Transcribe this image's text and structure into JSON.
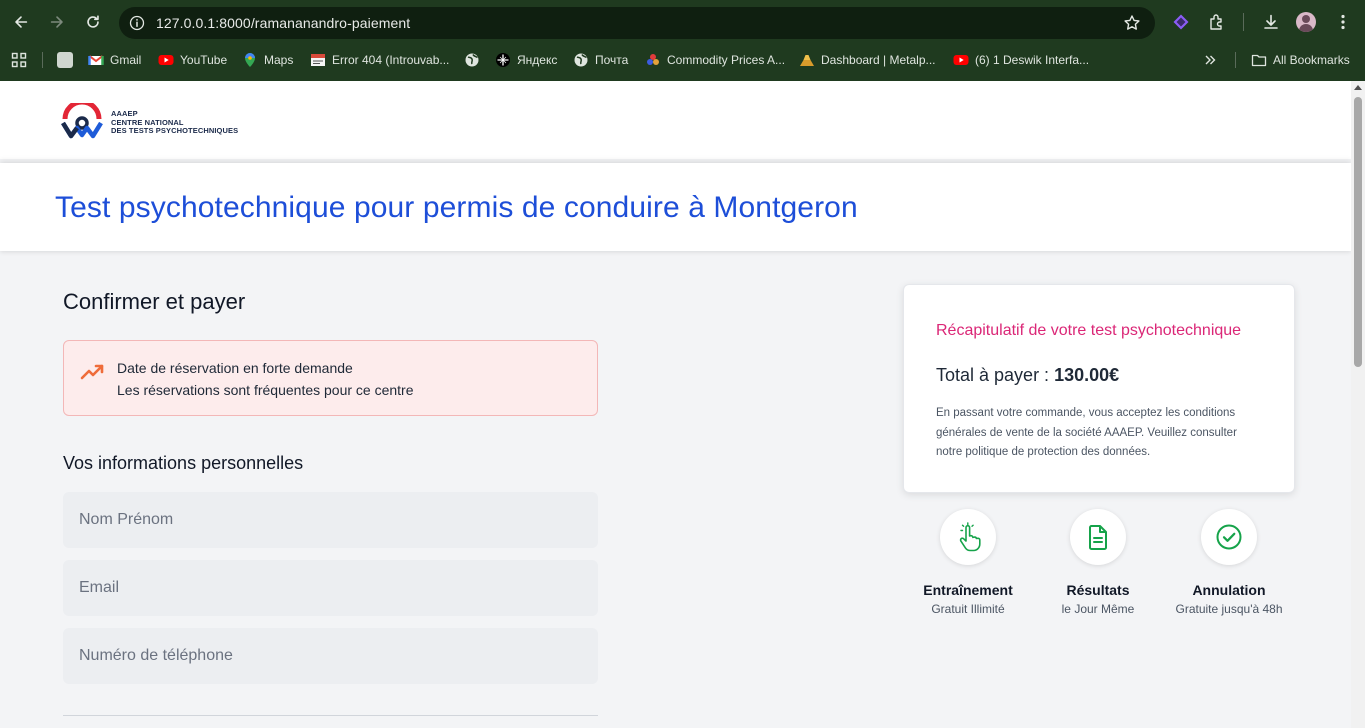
{
  "browser": {
    "url": "127.0.0.1:8000/ramananandro-paiement",
    "bookmarks": [
      {
        "label": "",
        "icon": "apps-grid-icon"
      },
      {
        "label": "",
        "icon": "page-icon"
      },
      {
        "label": "Gmail",
        "icon": "gmail-icon"
      },
      {
        "label": "YouTube",
        "icon": "youtube-icon"
      },
      {
        "label": "Maps",
        "icon": "maps-icon"
      },
      {
        "label": "Error 404 (Introuvab...",
        "icon": "error-page-icon"
      },
      {
        "label": "",
        "icon": "globe-icon"
      },
      {
        "label": "Яндекс",
        "icon": "yandex-icon"
      },
      {
        "label": "Почта",
        "icon": "globe-icon"
      },
      {
        "label": "Commodity Prices A...",
        "icon": "commodity-icon"
      },
      {
        "label": "Dashboard | Metalp...",
        "icon": "metalp-icon"
      },
      {
        "label": "(6) 1 Deswik Interfa...",
        "icon": "youtube-icon"
      }
    ],
    "all_bookmarks_label": "All Bookmarks"
  },
  "site": {
    "logo": {
      "line1": "AAAEP",
      "line2": "CENTRE NATIONAL",
      "line3": "DES TESTS PSYCHOTECHNIQUES"
    },
    "page_title": "Test psychotechnique pour permis de conduire à Montgeron"
  },
  "form": {
    "title": "Confirmer et payer",
    "alert": {
      "line1": "Date de réservation en forte demande",
      "line2": "Les réservations sont fréquentes pour ce centre"
    },
    "section_title": "Vos informations personnelles",
    "fields": {
      "name_placeholder": "Nom Prénom",
      "email_placeholder": "Email",
      "phone_placeholder": "Numéro de téléphone"
    }
  },
  "summary": {
    "title": "Récapitulatif de votre test psychotechnique",
    "total_label": "Total à payer : ",
    "total_value": "130.00€",
    "note": "En passant votre commande, vous acceptez les conditions générales de vente de la société AAAEP. Veuillez consulter notre politique de protection des données."
  },
  "features": [
    {
      "title": "Entraînement",
      "subtitle": "Gratuit Illimité",
      "icon": "hand-pointer-icon"
    },
    {
      "title": "Résultats",
      "subtitle": "le Jour Même",
      "icon": "document-icon"
    },
    {
      "title": "Annulation",
      "subtitle": "Gratuite jusqu'à 48h",
      "icon": "check-circle-icon"
    }
  ],
  "colors": {
    "accent_blue": "#1d4ed8",
    "accent_pink": "#db2777",
    "feature_green": "#16a34a",
    "alert_bg": "#fdecec",
    "alert_icon": "#ef6c3a",
    "chrome_bg": "#1f3a1f"
  }
}
